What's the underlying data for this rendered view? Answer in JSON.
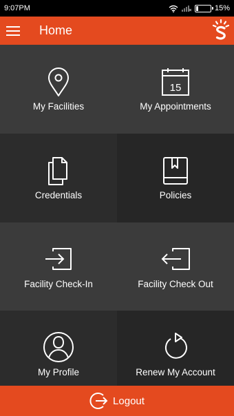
{
  "status_bar": {
    "time": "9:07PM",
    "battery": "15%",
    "battery_level": 0.15
  },
  "header": {
    "title": "Home",
    "menu_icon": "hamburger-menu-icon",
    "logo_icon": "brand-logo-icon"
  },
  "tiles": [
    {
      "label": "My Facilities",
      "icon": "location-pin-icon"
    },
    {
      "label": "My Appointments",
      "icon": "calendar-icon",
      "calendar_day": "15"
    },
    {
      "label": "Credentials",
      "icon": "documents-icon"
    },
    {
      "label": "Policies",
      "icon": "book-icon"
    },
    {
      "label": "Facility Check-In",
      "icon": "check-in-icon"
    },
    {
      "label": "Facility Check Out",
      "icon": "check-out-icon"
    },
    {
      "label": "My Profile",
      "icon": "user-icon"
    },
    {
      "label": "Renew My Account",
      "icon": "refresh-icon"
    }
  ],
  "footer": {
    "logout_label": "Logout",
    "logout_icon": "logout-icon"
  },
  "colors": {
    "accent": "#e44a1f",
    "tile_light": "#3b3b3b",
    "tile_dark": "#2c2c2c"
  }
}
